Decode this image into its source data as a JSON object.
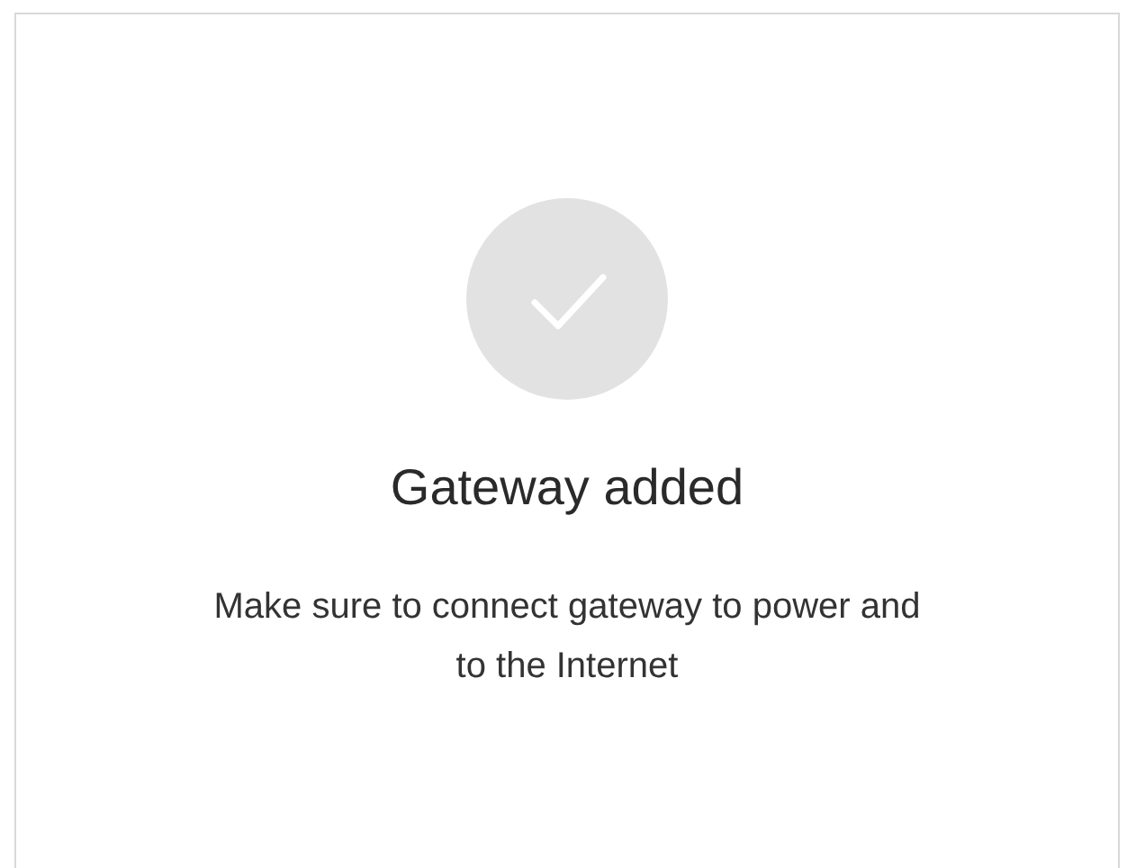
{
  "dialog": {
    "title": "Gateway added",
    "message": "Make sure to connect gateway to power and to the Internet"
  }
}
